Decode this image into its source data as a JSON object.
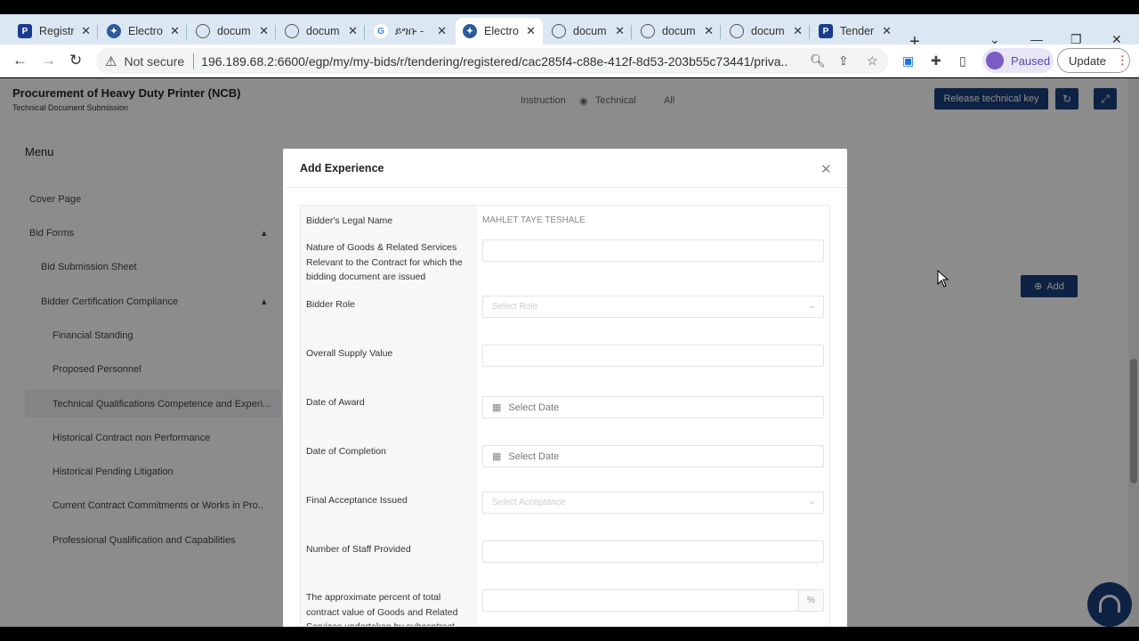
{
  "browser": {
    "tabs": [
      {
        "label": "Registr",
        "icon": "p-icon"
      },
      {
        "label": "Electro",
        "icon": "star-icon"
      },
      {
        "label": "docum",
        "icon": "globe-icon"
      },
      {
        "label": "docum",
        "icon": "globe-icon"
      },
      {
        "label": "ይግቡ -",
        "icon": "google-icon"
      },
      {
        "label": "Electro",
        "icon": "star-icon",
        "active": true
      },
      {
        "label": "docum",
        "icon": "globe-icon"
      },
      {
        "label": "docum",
        "icon": "globe-icon"
      },
      {
        "label": "docum",
        "icon": "globe-icon"
      },
      {
        "label": "Tender",
        "icon": "p-icon"
      }
    ],
    "security_label": "Not secure",
    "url": "196.189.68.2:6600/egp/my/my-bids/r/tendering/registered/cac285f4-c88e-412f-8d53-203b55c73441/priva...",
    "profile_status": "Paused",
    "update_label": "Update"
  },
  "page": {
    "title": "Procurement of Heavy Duty Printer (NCB)",
    "subtitle": "Technical Document Submission",
    "top_controls": {
      "instruction": "Instruction",
      "technical": "Technical",
      "all": "All"
    },
    "release_button": "Release technical key",
    "menu_heading": "Menu",
    "menu_items": [
      "Cover Page",
      "Bid Forms",
      "Bid Submission Sheet",
      "Bidder Certification Compliance",
      "Financial Standing",
      "Proposed Personnel",
      "Technical Qualifications Competence and Experi...",
      "Historical Contract non Performance",
      "Historical Pending Litigation",
      "Current Contract Commitments or Works in Pro...",
      "Professional Qualification and Capabilities"
    ],
    "add_button": "Add"
  },
  "modal": {
    "title": "Add Experience",
    "fields": {
      "legal_name_label": "Bidder's Legal Name",
      "legal_name_value": "MAHLET TAYE TESHALE",
      "nature_label": "Nature of Goods & Related Services Relevant to the Contract for which the bidding document are issued",
      "role_label": "Bidder Role",
      "role_placeholder": "Select Role",
      "supply_label": "Overall Supply Value",
      "award_label": "Date of Award",
      "award_placeholder": "Select Date",
      "completion_label": "Date of Completion",
      "completion_placeholder": "Select Date",
      "acceptance_label": "Final Acceptance Issued",
      "acceptance_placeholder": "Select Acceptance",
      "staff_label": "Number of Staff Provided",
      "percent_label": "The approximate percent of total contract value of Goods and Related Services undertaken by subcontract",
      "percent_suffix": "%"
    }
  }
}
